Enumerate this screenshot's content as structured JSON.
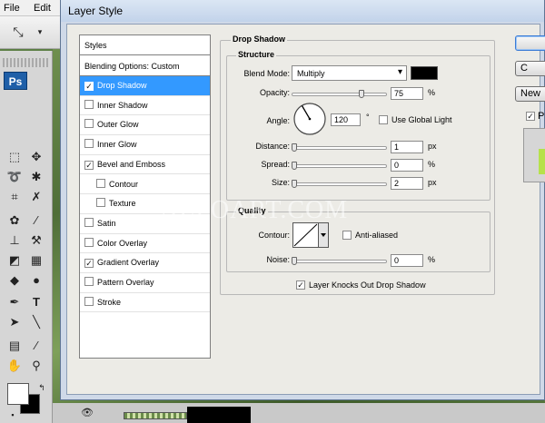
{
  "menubar": {
    "items": [
      "File",
      "Edit"
    ]
  },
  "toolbox": {
    "logo": "Ps"
  },
  "dialog": {
    "title": "Layer Style",
    "styles_list": {
      "header": "Styles",
      "blending_options": "Blending Options: Custom",
      "items": [
        {
          "label": "Drop Shadow",
          "checked": true,
          "selected": true
        },
        {
          "label": "Inner Shadow",
          "checked": false
        },
        {
          "label": "Outer Glow",
          "checked": false
        },
        {
          "label": "Inner Glow",
          "checked": false
        },
        {
          "label": "Bevel and Emboss",
          "checked": true
        },
        {
          "label": "Contour",
          "checked": false,
          "indent": true
        },
        {
          "label": "Texture",
          "checked": false,
          "indent": true
        },
        {
          "label": "Satin",
          "checked": false
        },
        {
          "label": "Color Overlay",
          "checked": false
        },
        {
          "label": "Gradient Overlay",
          "checked": true
        },
        {
          "label": "Pattern Overlay",
          "checked": false
        },
        {
          "label": "Stroke",
          "checked": false
        }
      ]
    },
    "drop_shadow": {
      "title": "Drop Shadow",
      "structure": {
        "title": "Structure",
        "blend_mode_label": "Blend Mode:",
        "blend_mode_value": "Multiply",
        "shadow_color": "#000000",
        "opacity_label": "Opacity:",
        "opacity_value": "75",
        "opacity_unit": "%",
        "angle_label": "Angle:",
        "angle_value": "120",
        "angle_unit": "°",
        "use_global_light_label": "Use Global Light",
        "use_global_light_checked": false,
        "distance_label": "Distance:",
        "distance_value": "1",
        "distance_unit": "px",
        "spread_label": "Spread:",
        "spread_value": "0",
        "spread_unit": "%",
        "size_label": "Size:",
        "size_value": "2",
        "size_unit": "px"
      },
      "quality": {
        "title": "Quality",
        "contour_label": "Contour:",
        "anti_aliased_label": "Anti-aliased",
        "anti_aliased_checked": false,
        "noise_label": "Noise:",
        "noise_value": "0",
        "noise_unit": "%"
      },
      "layer_knocks_out_label": "Layer Knocks Out Drop Shadow",
      "layer_knocks_out_checked": true
    },
    "buttons": {
      "cancel_partial": "C",
      "new_style_partial": "New",
      "preview_partial": "P"
    }
  },
  "watermark": "ALFOART.COM",
  "colors": {
    "selection": "#3399ff",
    "dialog_frame": "#cfd9e8",
    "dialog_face": "#ecebe6",
    "preview_swatch": "#b6e14b"
  }
}
